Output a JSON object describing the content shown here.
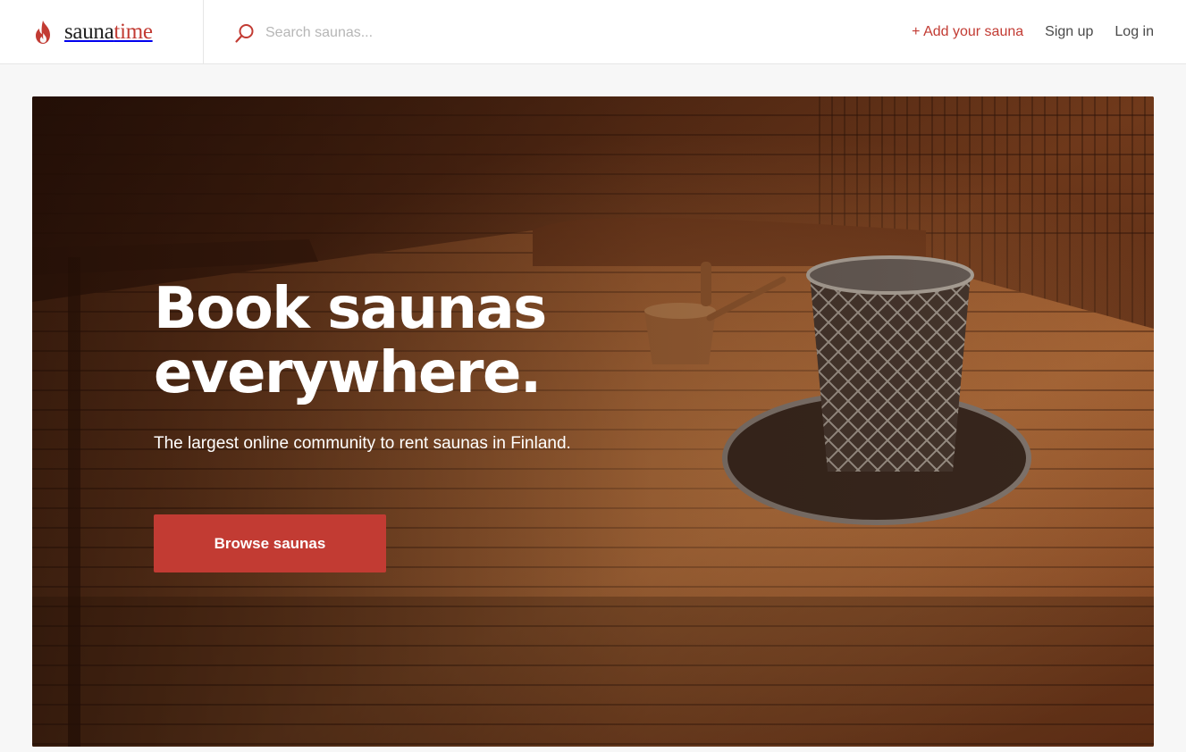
{
  "brand": {
    "name_part1": "sauna",
    "name_part2": "time",
    "accent_color": "#c23b33",
    "logo_icon": "flame-icon"
  },
  "search": {
    "placeholder": "Search saunas...",
    "value": "",
    "icon": "search-icon"
  },
  "nav": {
    "add_sauna": "+ Add your sauna",
    "sign_up": "Sign up",
    "log_in": "Log in"
  },
  "hero": {
    "title_line1": "Book saunas",
    "title_line2": "everywhere.",
    "subtitle": "The largest online community to rent saunas in Finland.",
    "button_label": "Browse saunas",
    "button_color": "#c23b33"
  }
}
